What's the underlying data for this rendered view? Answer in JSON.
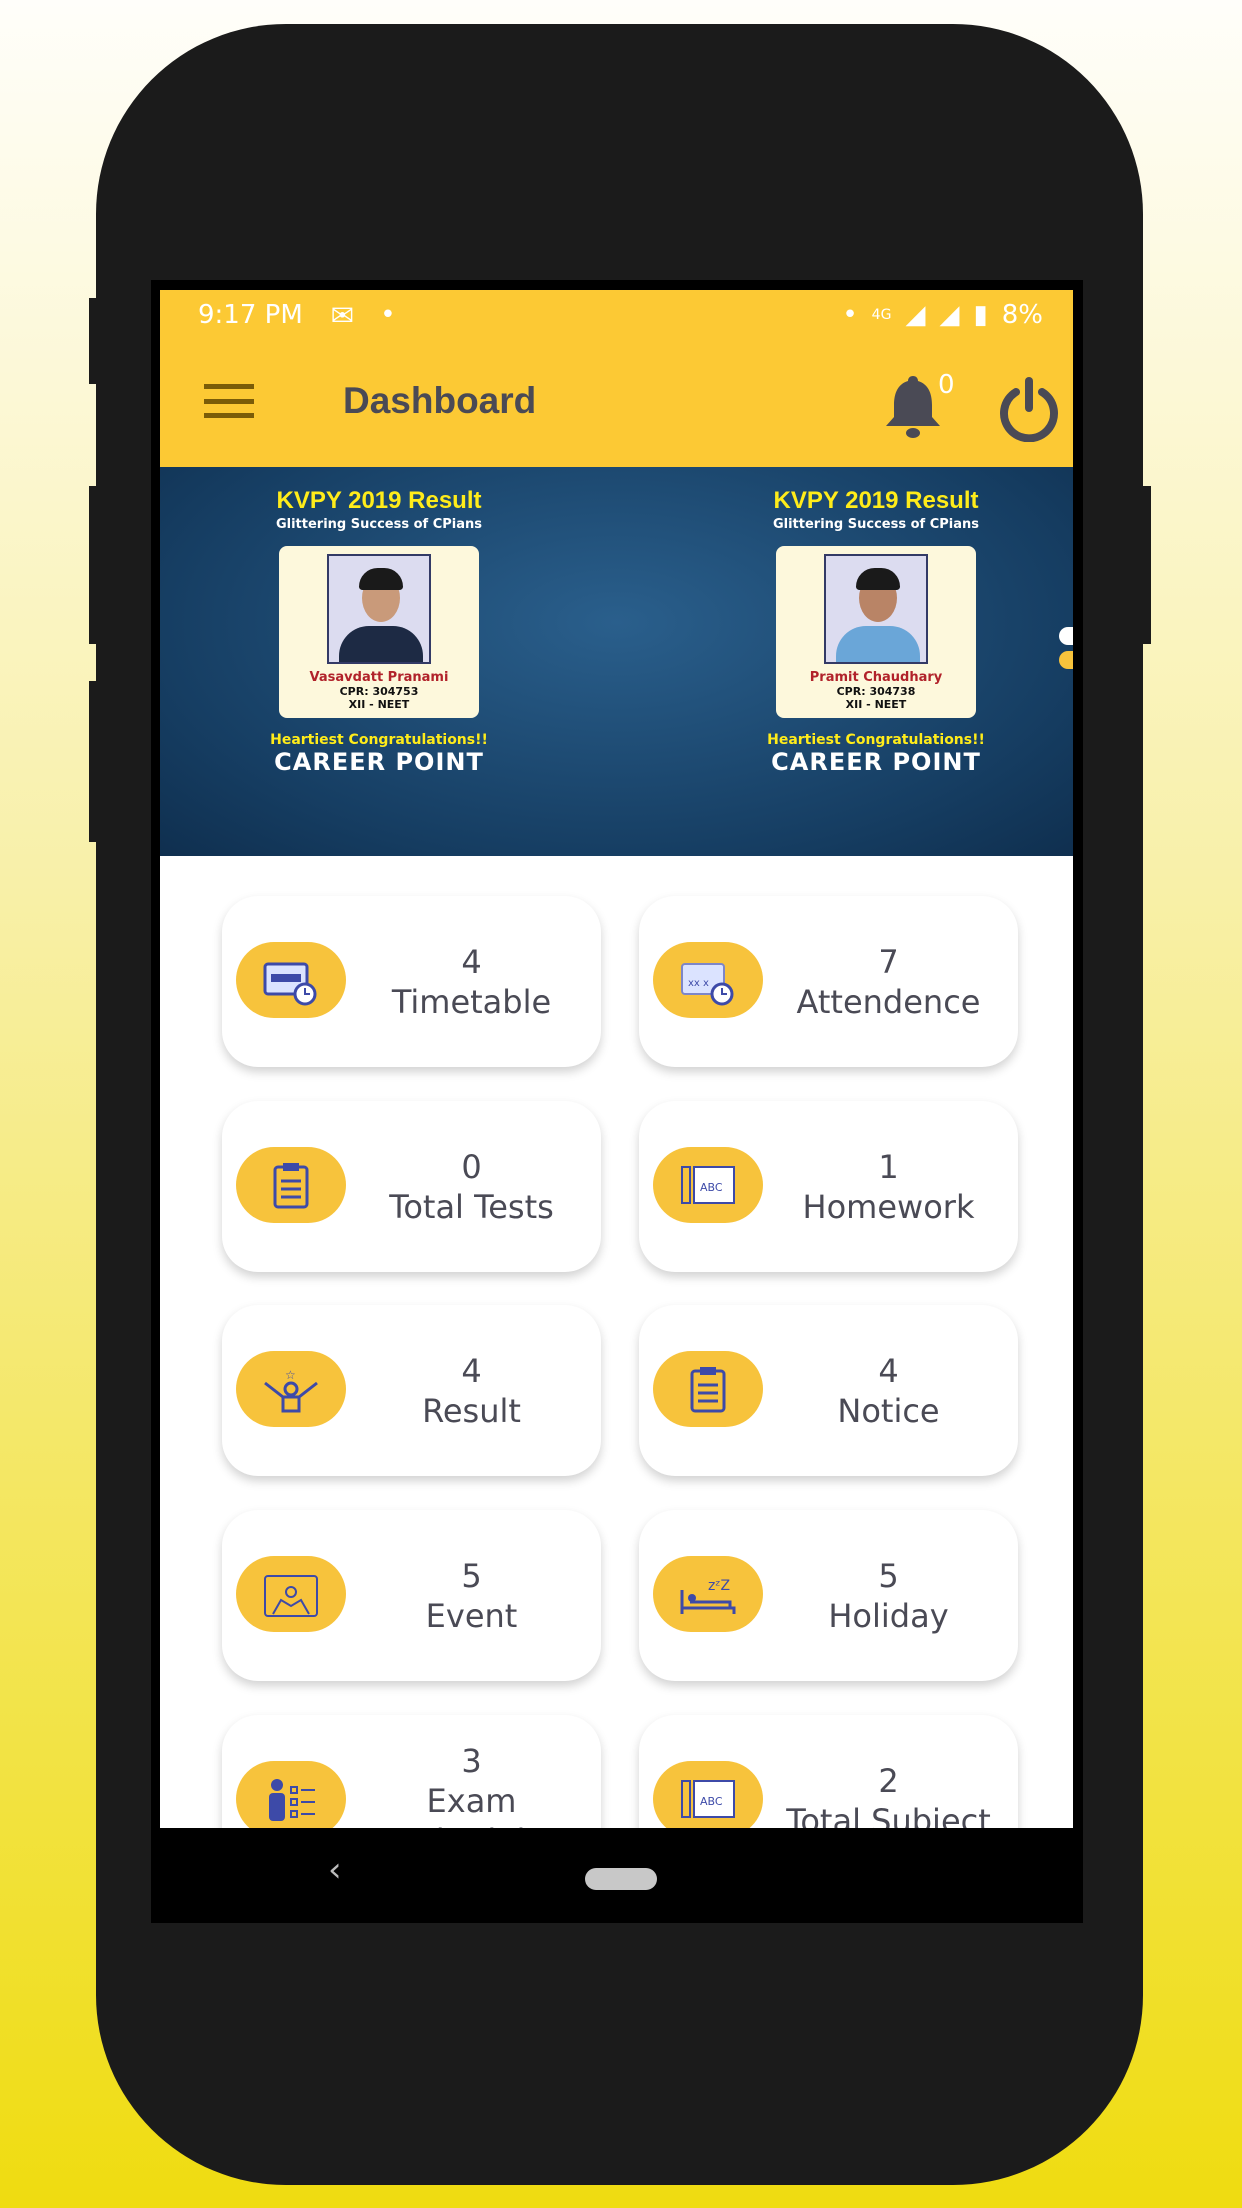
{
  "status_bar": {
    "time": "9:17 PM",
    "network": "4G",
    "battery": "8%"
  },
  "header": {
    "title": "Dashboard",
    "notification_count": "0"
  },
  "banner": {
    "slides": [
      {
        "title": "KVPY 2019 Result",
        "subtitle": "Glittering Success of CPians",
        "name": "Vasavdatt Pranami",
        "cpr": "CPR: 304753",
        "class": "XII - NEET",
        "congrats": "Heartiest Congratulations!!",
        "brand": "CAREER POINT"
      },
      {
        "title": "KVPY 2019 Result",
        "subtitle": "Glittering Success of CPians",
        "name": "Pramit Chaudhary",
        "cpr": "CPR: 304738",
        "class": "XII - NEET",
        "congrats": "Heartiest Congratulations!!",
        "brand": "CAREER POINT"
      }
    ]
  },
  "tiles": [
    {
      "count": "4",
      "label": "Timetable",
      "icon": "calendar-clock-icon"
    },
    {
      "count": "7",
      "label": "Attendence",
      "icon": "attendance-calendar-icon"
    },
    {
      "count": "0",
      "label": "Total Tests",
      "icon": "clipboard-icon"
    },
    {
      "count": "1",
      "label": "Homework",
      "icon": "abc-book-icon"
    },
    {
      "count": "4",
      "label": "Result",
      "icon": "winner-icon"
    },
    {
      "count": "4",
      "label": "Notice",
      "icon": "clipboard-icon"
    },
    {
      "count": "5",
      "label": "Event",
      "icon": "event-icon"
    },
    {
      "count": "5",
      "label": "Holiday",
      "icon": "sleep-icon"
    },
    {
      "count": "3",
      "label": "Exam Schedule",
      "icon": "checklist-person-icon"
    },
    {
      "count": "2",
      "label": "Total Subject",
      "icon": "abc-book-icon"
    }
  ],
  "colors": {
    "accent": "#fcc934",
    "icon_bg": "#f7c33c",
    "text": "#4a4a55",
    "icon_stroke": "#3d4aa8"
  }
}
